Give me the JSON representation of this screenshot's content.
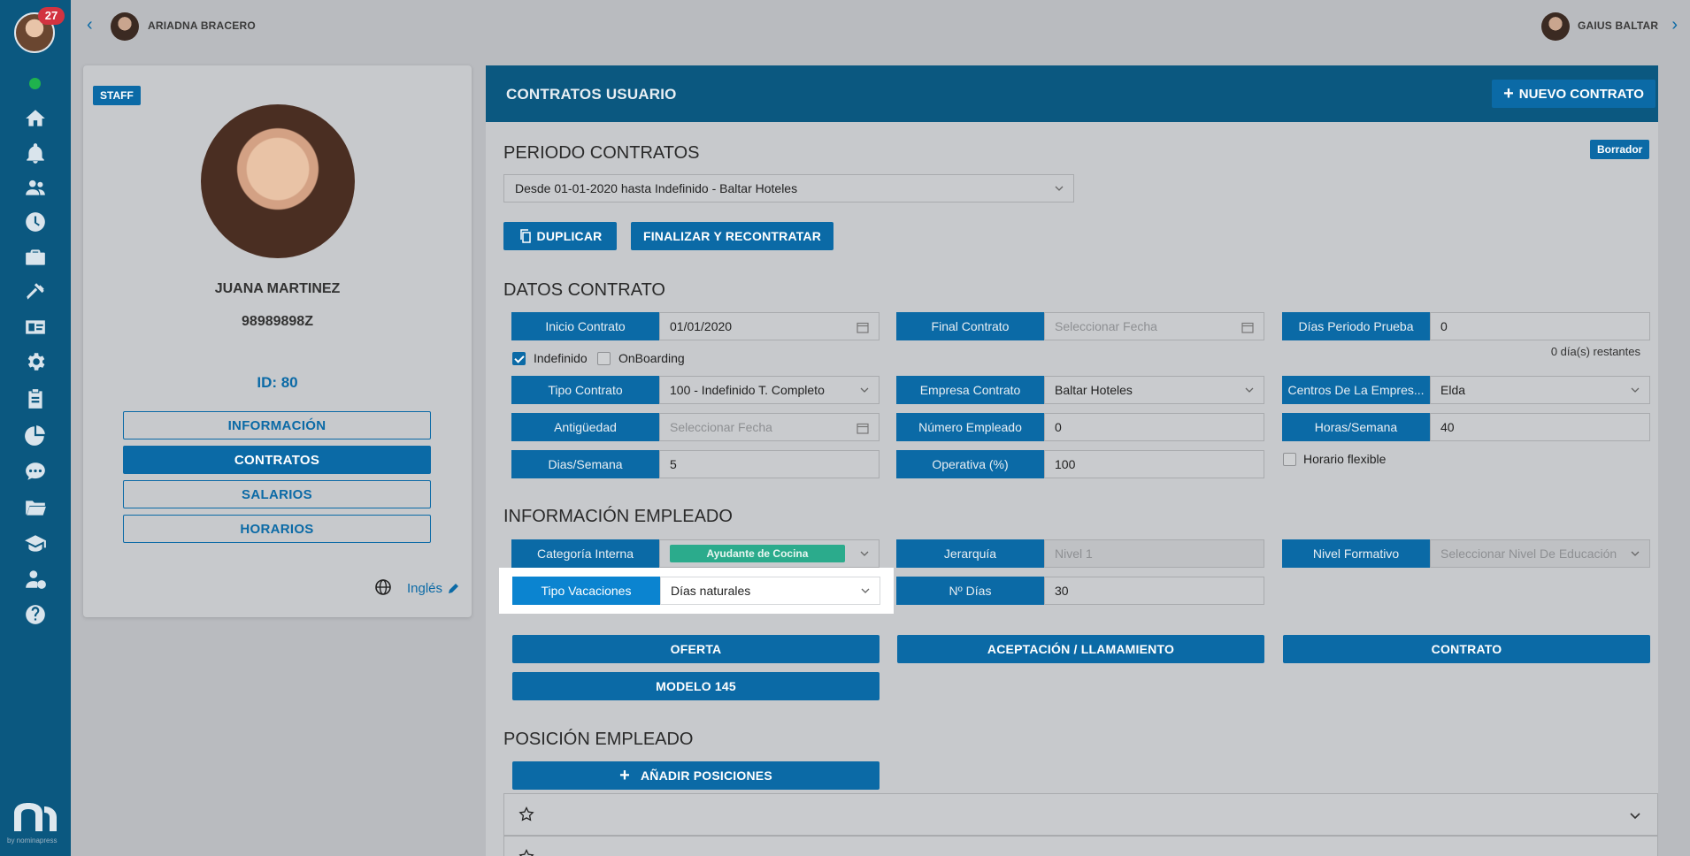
{
  "sidebar": {
    "notification_count": "27",
    "logo_text": "by nominapress",
    "icons": [
      "home-icon",
      "bell-icon",
      "users-icon",
      "clock-icon",
      "briefcase-icon",
      "tools-icon",
      "id-card-icon",
      "gear-icon",
      "clipboard-icon",
      "pie-chart-icon",
      "chat-icon",
      "folder-icon",
      "graduation-cap-icon",
      "user-money-icon",
      "help-icon"
    ]
  },
  "topbar": {
    "prev_user": "ARIADNA BRACERO",
    "next_user": "GAIUS BALTAR"
  },
  "profile": {
    "badge": "STAFF",
    "name": "JUANA MARTINEZ",
    "dni": "98989898Z",
    "id_label": "ID: 80",
    "nav": [
      "INFORMACIÓN",
      "CONTRATOS",
      "SALARIOS",
      "HORARIOS"
    ],
    "active_nav": "CONTRATOS",
    "language": "Inglés"
  },
  "main": {
    "title": "CONTRATOS USUARIO",
    "new_contract_label": "NUEVO CONTRATO",
    "periodo_title": "PERIODO CONTRATOS",
    "status_badge": "Borrador",
    "period_selected": "Desde 01-01-2020 hasta Indefinido - Baltar Hoteles",
    "duplicate_label": "DUPLICAR",
    "finalize_label": "FINALIZAR Y RECONTRATAR",
    "datos_title": "DATOS CONTRATO",
    "fields": {
      "inicio": {
        "label": "Inicio Contrato",
        "value": "01/01/2020"
      },
      "final": {
        "label": "Final Contrato",
        "placeholder": "Seleccionar Fecha"
      },
      "prueba": {
        "label": "Días Periodo Prueba",
        "value": "0"
      },
      "restantes": "0 día(s) restantes",
      "indefinido": "Indefinido",
      "onboarding": "OnBoarding",
      "tipo": {
        "label": "Tipo Contrato",
        "value": "100 - Indefinido T. Completo"
      },
      "empresa": {
        "label": "Empresa Contrato",
        "value": "Baltar Hoteles"
      },
      "centros": {
        "label": "Centros De La Empres...",
        "value": "Elda"
      },
      "antiguedad": {
        "label": "Antigüedad",
        "placeholder": "Seleccionar Fecha"
      },
      "numero": {
        "label": "Número Empleado",
        "value": "0"
      },
      "horas": {
        "label": "Horas/Semana",
        "value": "40"
      },
      "dias": {
        "label": "Dias/Semana",
        "value": "5"
      },
      "operativa": {
        "label": "Operativa (%)",
        "value": "100"
      },
      "flexible": "Horario flexible"
    },
    "info_title": "INFORMACIÓN EMPLEADO",
    "info": {
      "categoria": {
        "label": "Categoría Interna",
        "value": "Ayudante de Cocina"
      },
      "jerarquia": {
        "label": "Jerarquía",
        "value": "Nivel 1"
      },
      "nivel": {
        "label": "Nivel Formativo",
        "placeholder": "Seleccionar Nivel De Educación"
      },
      "vacaciones": {
        "label": "Tipo Vacaciones",
        "value": "Días naturales"
      },
      "ndias": {
        "label": "Nº Días",
        "value": "30"
      }
    },
    "doc_buttons": [
      "OFERTA",
      "ACEPTACIÓN / LLAMAMIENTO",
      "CONTRATO",
      "MODELO 145"
    ],
    "posicion_title": "POSICIÓN EMPLEADO",
    "add_positions_label": "AÑADIR POSICIONES"
  },
  "colors": {
    "sidebar": "#0b5880",
    "primary": "#0b6aa6",
    "chip": "#2bab8c",
    "badge": "#d23340"
  }
}
